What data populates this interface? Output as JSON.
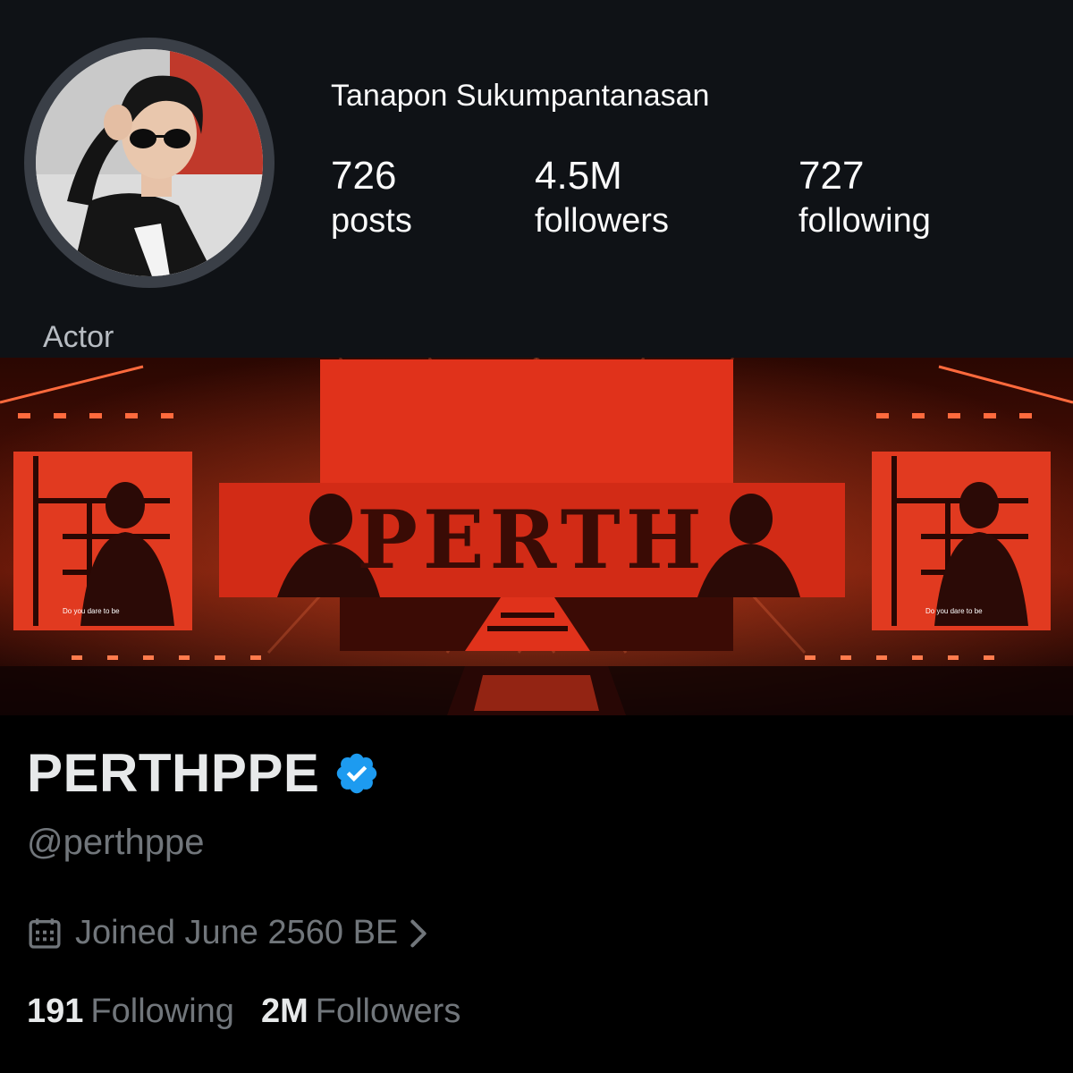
{
  "instagram": {
    "display_name": "Tanapon Sukumpantanasan",
    "stats": [
      {
        "value": "726",
        "label": "posts"
      },
      {
        "value": "4.5M",
        "label": "followers"
      },
      {
        "value": "727",
        "label": "following"
      }
    ],
    "bio": "Actor"
  },
  "banner": {
    "stage_logo_text": "PERTH",
    "screen_caption": "Do you dare to be"
  },
  "x_profile": {
    "name": "PERTHPPE",
    "verified_color": "#1d9bf0",
    "handle": "@perthppe",
    "joined": "Joined June 2560 BE",
    "following_count": "191",
    "following_label": "Following",
    "followers_count": "2M",
    "followers_label": "Followers"
  },
  "colors": {
    "ig_background": "#0f1216",
    "x_background": "#000000",
    "muted_text": "#71767b",
    "stage_red": "#e0321b"
  },
  "icons": [
    "verified-badge-icon",
    "calendar-icon",
    "chevron-right-icon"
  ]
}
